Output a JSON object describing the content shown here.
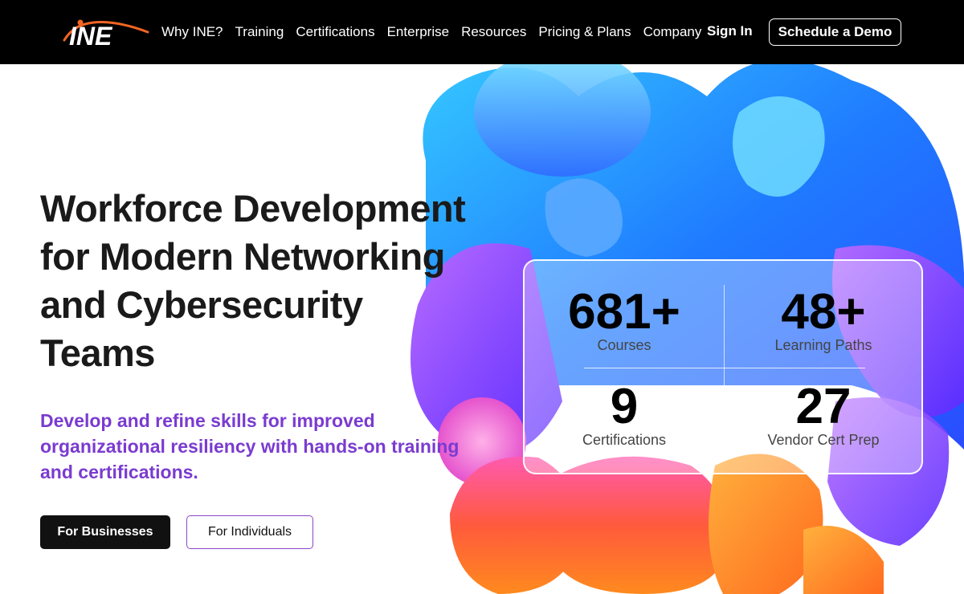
{
  "brand": {
    "logo_text": "INE",
    "accent": "#f26522"
  },
  "nav": {
    "links": [
      "Why INE?",
      "Training",
      "Certifications",
      "Enterprise",
      "Resources",
      "Pricing & Plans",
      "Company"
    ],
    "sign_in": "Sign In",
    "demo": "Schedule a Demo"
  },
  "hero": {
    "title_lines": [
      "Workforce Development",
      "for Modern Networking",
      "and Cybersecurity",
      "Teams"
    ],
    "subtitle_lines": [
      "Develop and refine skills for improved",
      "organizational resiliency with hands-on training",
      "and certifications."
    ],
    "buttons": {
      "businesses": "For Businesses",
      "individuals": "For Individuals"
    }
  },
  "stats": [
    {
      "value": "681+",
      "label": "Courses"
    },
    {
      "value": "48+",
      "label": "Learning Paths"
    },
    {
      "value": "9",
      "label": "Certifications"
    },
    {
      "value": "27",
      "label": "Vendor Cert Prep"
    }
  ],
  "colors": {
    "nav_bg": "#000000",
    "subtitle": "#7a3bd0",
    "button_dark": "#111111",
    "button_outline": "#8b45c8"
  }
}
